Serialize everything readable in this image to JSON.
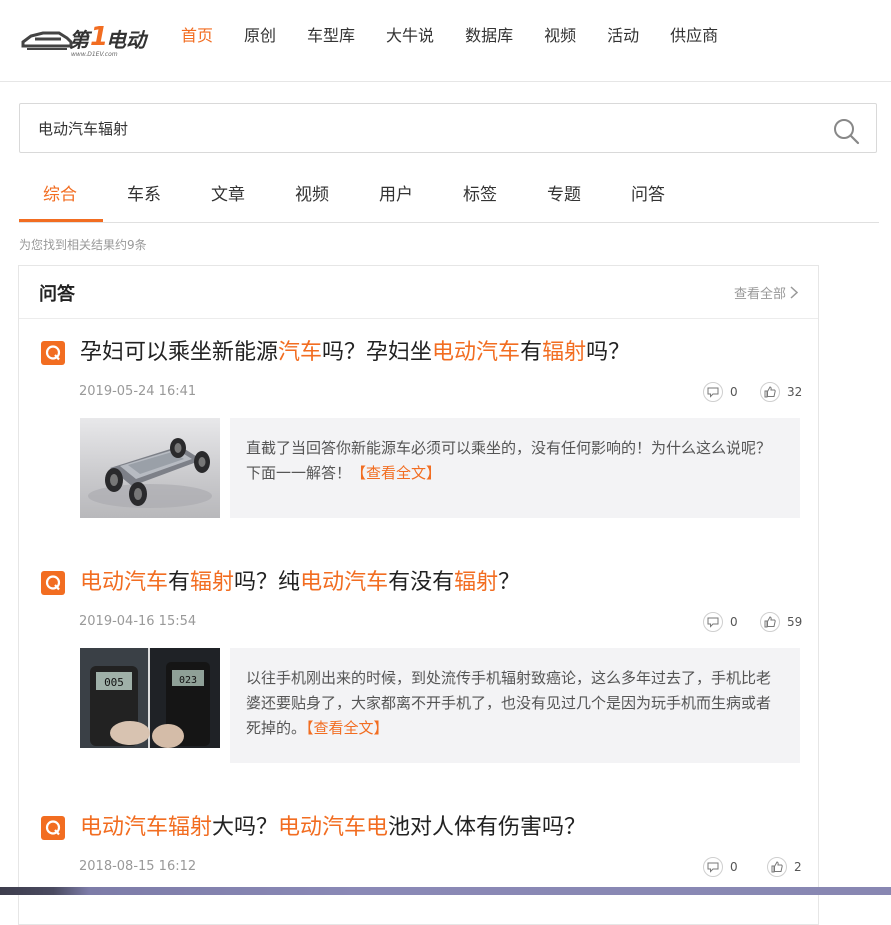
{
  "header": {
    "logo_text": "第1电动",
    "logo_sub": "www.D1EV.com",
    "nav": [
      {
        "label": "首页",
        "active": true
      },
      {
        "label": "原创"
      },
      {
        "label": "车型库"
      },
      {
        "label": "大牛说"
      },
      {
        "label": "数据库"
      },
      {
        "label": "视频"
      },
      {
        "label": "活动"
      },
      {
        "label": "供应商"
      }
    ]
  },
  "search": {
    "value": "电动汽车辐射",
    "button_icon": "search-icon"
  },
  "tabs": [
    {
      "label": "综合",
      "active": true
    },
    {
      "label": "车系"
    },
    {
      "label": "文章"
    },
    {
      "label": "视频"
    },
    {
      "label": "用户"
    },
    {
      "label": "标签"
    },
    {
      "label": "专题"
    },
    {
      "label": "问答"
    }
  ],
  "result_count": "为您找到相关结果约9条",
  "card": {
    "title": "问答",
    "view_all": "查看全部"
  },
  "questions": [
    {
      "title_parts": [
        {
          "text": "孕妇可以乘坐新能源",
          "hl": false
        },
        {
          "text": "汽车",
          "hl": true
        },
        {
          "text": "吗？孕妇坐",
          "hl": false
        },
        {
          "text": "电动汽车",
          "hl": true
        },
        {
          "text": "有",
          "hl": false
        },
        {
          "text": "辐射",
          "hl": true
        },
        {
          "text": "吗？",
          "hl": false
        }
      ],
      "date": "2019-05-24 16:41",
      "comments": "0",
      "likes": "32",
      "excerpt": "直截了当回答你新能源车必须可以乘坐的，没有任何影响的！为什么这么说呢？下面一一解答！",
      "more": "【查看全文】"
    },
    {
      "title_parts": [
        {
          "text": "电动汽车",
          "hl": true
        },
        {
          "text": "有",
          "hl": false
        },
        {
          "text": "辐射",
          "hl": true
        },
        {
          "text": "吗？纯",
          "hl": false
        },
        {
          "text": "电动汽车",
          "hl": true
        },
        {
          "text": "有没有",
          "hl": false
        },
        {
          "text": "辐射",
          "hl": true
        },
        {
          "text": "？",
          "hl": false
        }
      ],
      "date": "2019-04-16 15:54",
      "comments": "0",
      "likes": "59",
      "excerpt": "以往手机刚出来的时候，到处流传手机辐射致癌论，这么多年过去了，手机比老婆还要贴身了，大家都离不开手机了，也没有见过几个是因为玩手机而生病或者死掉的。",
      "more": "【查看全文】",
      "meter_readings": [
        "005",
        "023"
      ]
    },
    {
      "title_parts": [
        {
          "text": "电动汽车辐射",
          "hl": true
        },
        {
          "text": "大吗？",
          "hl": false
        },
        {
          "text": "电动汽车电",
          "hl": true
        },
        {
          "text": "池对人体有伤害吗？",
          "hl": false
        }
      ],
      "date": "2018-08-15 16:12",
      "comments": "0",
      "likes": "2"
    }
  ],
  "colors": {
    "accent": "#f26d21",
    "text": "#333333",
    "muted": "#999999",
    "excerpt_bg": "#f3f3f5"
  }
}
